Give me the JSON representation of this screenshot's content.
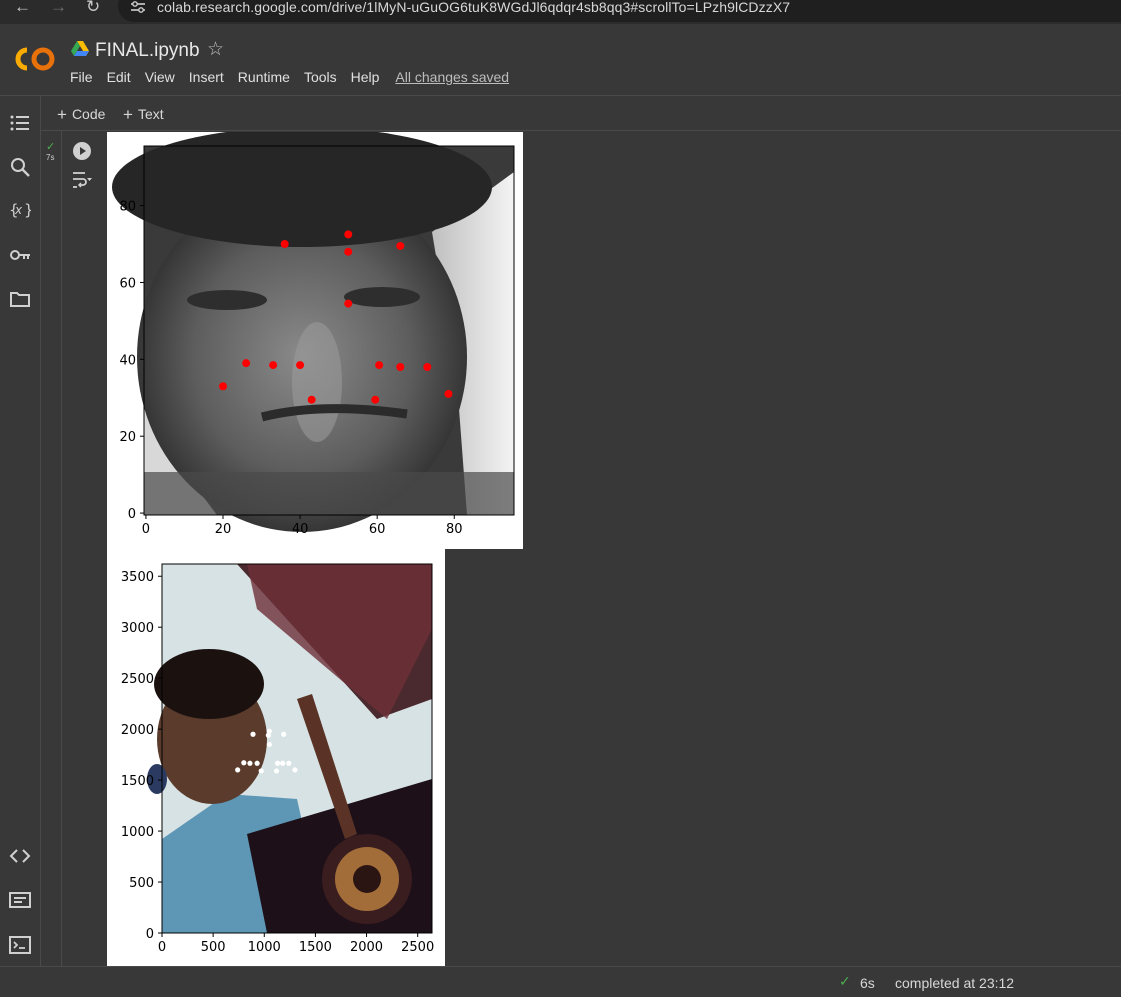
{
  "browser": {
    "url": "colab.research.google.com/drive/1lMyN-uGuOG6tuK8WGdJl6qdqr4sb8qq3#scrollTo=LPzh9lCDzzX7"
  },
  "header": {
    "title": "FINAL.ipynb",
    "menu": [
      "File",
      "Edit",
      "View",
      "Insert",
      "Runtime",
      "Tools",
      "Help"
    ],
    "save_status": "All changes saved"
  },
  "toolbar": {
    "code_label": "Code",
    "text_label": "Text"
  },
  "sidebar": {
    "icons": [
      "table-of-contents-icon",
      "search-icon",
      "variables-icon",
      "secrets-key-icon",
      "files-folder-icon",
      "code-snippets-icon",
      "command-palette-icon",
      "terminal-icon"
    ]
  },
  "cell": {
    "exec_time": "7s"
  },
  "status": {
    "time": "6s",
    "completed": "completed at 23:12"
  },
  "colors": {
    "landmark_fig1": "#ff0000",
    "landmark_fig2": "#ffffff",
    "success": "#4caf50"
  },
  "chart_data": [
    {
      "type": "scatter",
      "description_of_background": "grayscale face image",
      "xlim": [
        -0.5,
        95.5
      ],
      "ylim": [
        95.5,
        -0.5
      ],
      "xticks": [
        0,
        20,
        40,
        60,
        80
      ],
      "yticks": [
        0,
        20,
        40,
        60,
        80
      ],
      "points": [
        [
          20,
          33
        ],
        [
          26,
          39
        ],
        [
          33,
          38.5
        ],
        [
          40,
          38.5
        ],
        [
          43,
          29.5
        ],
        [
          59.5,
          29.5
        ],
        [
          60.5,
          38.5
        ],
        [
          66,
          38
        ],
        [
          73,
          38
        ],
        [
          78.5,
          31
        ],
        [
          52.5,
          54.5
        ],
        [
          36,
          70
        ],
        [
          52.5,
          68
        ],
        [
          66,
          69.5
        ],
        [
          52.5,
          72.5
        ]
      ]
    },
    {
      "type": "scatter",
      "description_of_background": "color photo of person holding guitar",
      "xlim": [
        0,
        2640
      ],
      "ylim": [
        3620,
        0
      ],
      "xticks": [
        0,
        500,
        1000,
        1500,
        2000,
        2500
      ],
      "yticks": [
        0,
        500,
        1000,
        1500,
        2000,
        2500,
        3000,
        3500
      ],
      "points": [
        [
          740,
          1600
        ],
        [
          800,
          1670
        ],
        [
          860,
          1665
        ],
        [
          930,
          1665
        ],
        [
          970,
          1590
        ],
        [
          1120,
          1590
        ],
        [
          1130,
          1665
        ],
        [
          1180,
          1665
        ],
        [
          1240,
          1665
        ],
        [
          1300,
          1600
        ],
        [
          1050,
          1850
        ],
        [
          890,
          1950
        ],
        [
          1040,
          1940
        ],
        [
          1190,
          1950
        ],
        [
          1050,
          1980
        ]
      ]
    }
  ]
}
